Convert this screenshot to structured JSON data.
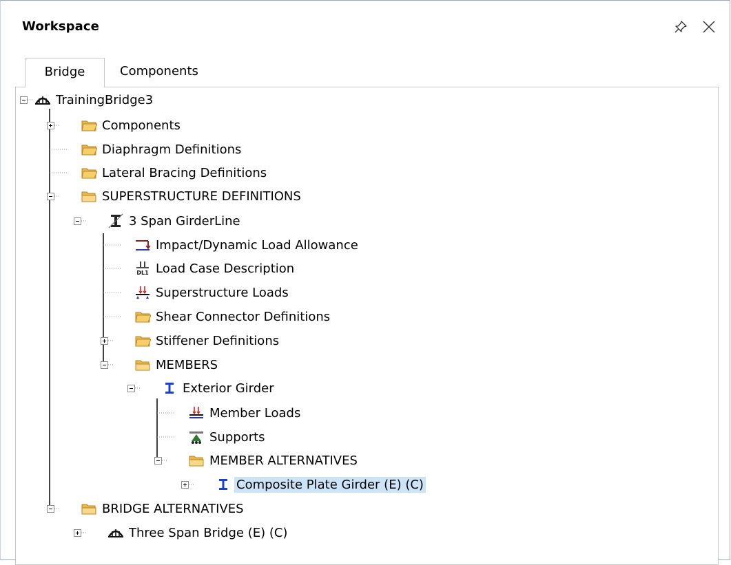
{
  "window": {
    "title": "Workspace"
  },
  "tabs": [
    {
      "label": "Bridge",
      "active": true
    },
    {
      "label": "Components",
      "active": false
    }
  ],
  "tree": {
    "root": "TrainingBridge3",
    "components": "Components",
    "diaphragm_definitions": "Diaphragm Definitions",
    "lateral_bracing_definitions": "Lateral Bracing Definitions",
    "superstructure_definitions": "SUPERSTRUCTURE DEFINITIONS",
    "girderline": "3 Span GirderLine",
    "impact_allowance": "Impact/Dynamic Load Allowance",
    "load_case_description": "Load Case Description",
    "superstructure_loads": "Superstructure Loads",
    "shear_connector_definitions": "Shear Connector Definitions",
    "stiffener_definitions": "Stiffener Definitions",
    "members": "MEMBERS",
    "exterior_girder": "Exterior Girder",
    "member_loads": "Member Loads",
    "supports": "Supports",
    "member_alternatives": "MEMBER ALTERNATIVES",
    "composite_plate_girder": "Composite Plate Girder (E)  (C)",
    "bridge_alternatives": "BRIDGE ALTERNATIVES",
    "three_span_bridge": "Three Span Bridge (E)  (C)"
  },
  "icons": {
    "bridge": "bridge-icon",
    "folder_closed": "folder-icon",
    "folder_open": "folder-open-icon",
    "girderline": "girderline-icon",
    "member": "i-beam-icon",
    "impact": "impact-load-icon",
    "load_case": "load-case-icon",
    "loads": "loads-icon",
    "supports": "supports-icon"
  },
  "colors": {
    "selection": "#cce4f7",
    "member_icon": "#1a3fd6",
    "folder": "#f3c55a",
    "tree_lines": "#000000"
  }
}
